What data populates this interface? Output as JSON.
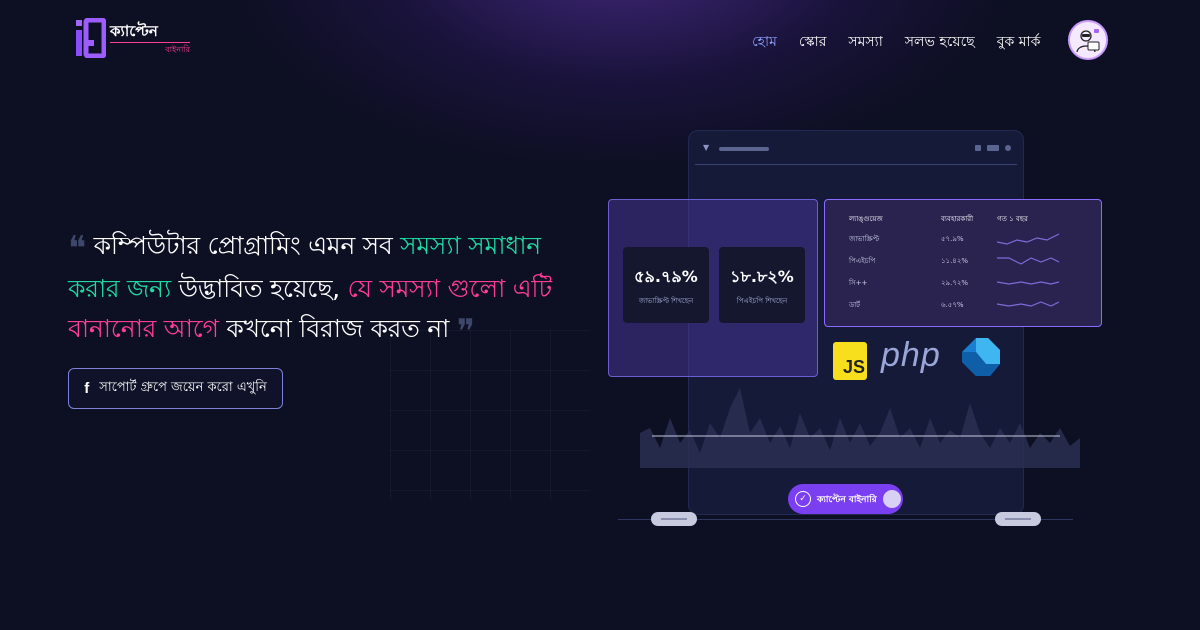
{
  "brand": {
    "name": "ক্যাপ্টেন",
    "tagline": "বাইনারি"
  },
  "nav": {
    "items": [
      {
        "label": "হোম",
        "active": true
      },
      {
        "label": "স্কোর",
        "active": false
      },
      {
        "label": "সমস্যা",
        "active": false
      },
      {
        "label": "সলভ হয়েছে",
        "active": false
      },
      {
        "label": "বুক মার্ক",
        "active": false
      }
    ]
  },
  "hero": {
    "quote_open": "❝",
    "quote_close": "❞",
    "part1": "কম্পিউটার প্রোগ্রামিং এমন সব ",
    "part2": "সমস্যা সমাধান করার জন্য",
    "part3": " উদ্ভাবিত হয়েছে, ",
    "part4": "যে সমস্যা গুলো এটি বানানোর আগে",
    "part5": " কখনো বিরাজ করত না",
    "cta_label": "সাপোর্ট গ্রুপে জয়েন করো এখুনি",
    "cta_icon": "facebook-icon"
  },
  "illustration": {
    "stats": [
      {
        "value": "৫৯.৭৯%",
        "label": "জাভাস্ক্রিপ্ট শিখছেন"
      },
      {
        "value": "১৮.৮২%",
        "label": "পিএইচপি শিখছেন"
      }
    ],
    "table": {
      "headers": [
        "ল্যাঙ্গুয়েজ",
        "ব্যবহারকারী",
        "গত ১ বছর"
      ],
      "rows": [
        {
          "name": "জাভাস্ক্রিপ্ট",
          "value": "৫৭.৯%"
        },
        {
          "name": "পিএইচপি",
          "value": "১১.৪২%"
        },
        {
          "name": "সি++",
          "value": "২৯.৭২%"
        },
        {
          "name": "ডার্ট",
          "value": "৬.৫৭%"
        }
      ]
    },
    "languages": {
      "js": "JS",
      "php": "php",
      "dart": "dart-logo"
    },
    "badge_label": "ক্যাপ্টেন বাইনারি"
  },
  "colors": {
    "accent_green": "#1ed9a4",
    "accent_pink": "#ff3d9a",
    "brand_purple": "#7b3ff2",
    "nav_active": "#8ea2ff"
  }
}
